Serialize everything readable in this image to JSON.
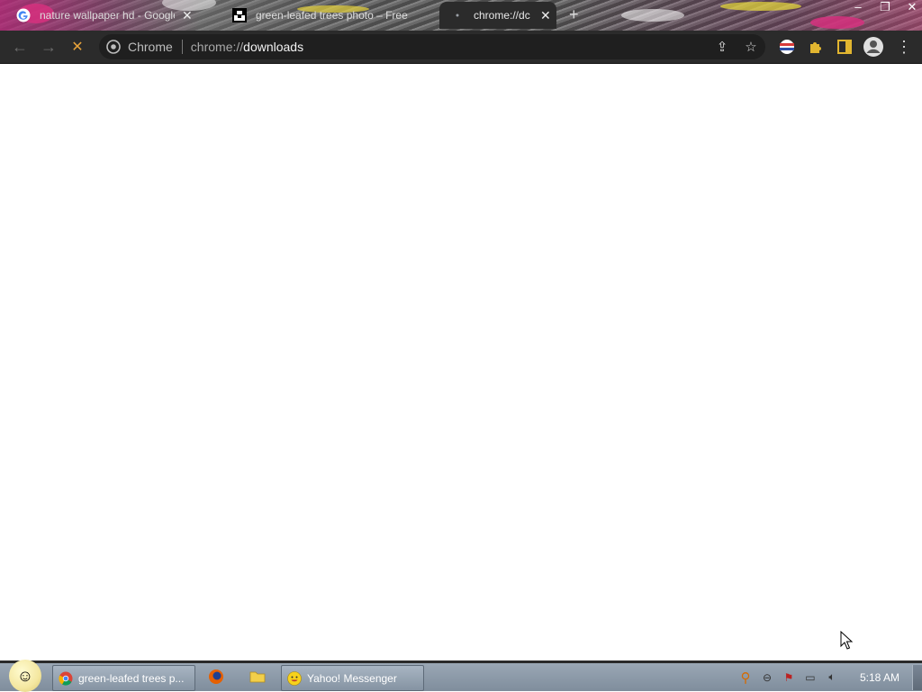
{
  "browser": {
    "tabs": [
      {
        "title": "nature wallpaper hd - Google Se",
        "active": false,
        "icon": "google-g-icon"
      },
      {
        "title": "green-leafed trees photo – Free",
        "active": false,
        "icon": "unsplash-icon"
      },
      {
        "title": "chrome://dc",
        "active": true,
        "icon": "loading-icon"
      }
    ],
    "new_tab_label": "+",
    "window_controls": {
      "minimize": "–",
      "restore": "❐",
      "close": "✕"
    },
    "toolbar": {
      "back": "←",
      "forward": "→",
      "stop": "✕",
      "omnibox_chip": "Chrome",
      "url_scheme": "chrome://",
      "url_host": "downloads",
      "share_icon": "⇪",
      "star_icon": "☆",
      "menu_icon": "⋮"
    }
  },
  "taskbar": {
    "items": [
      {
        "label": "green-leafed trees p...",
        "icon": "chrome-icon"
      },
      {
        "label": "Yahoo! Messenger",
        "icon": "yahoo-messenger-icon"
      }
    ],
    "clock": "5:18 AM"
  },
  "colors": {
    "toolbar_bg": "#2b2b2b",
    "content_bg": "#ffffff",
    "loading_spinner": "#e9a43b",
    "extension_gold": "#e1b530"
  }
}
